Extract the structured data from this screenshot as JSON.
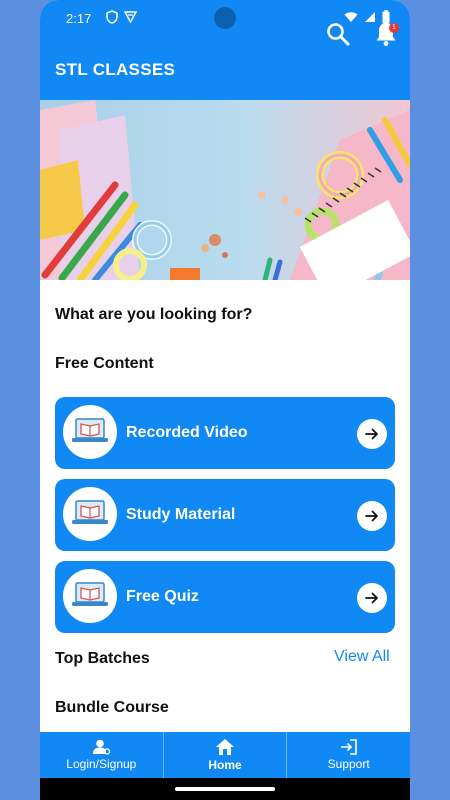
{
  "status": {
    "time": "2:17",
    "left_icons": [
      "shield-icon",
      "vpn-icon"
    ],
    "right_icons": [
      "wifi-icon",
      "signal-icon",
      "battery-icon"
    ]
  },
  "appbar": {
    "title": "STL CLASSES",
    "notification_count": "1",
    "icons": [
      "search-icon",
      "bell-icon"
    ]
  },
  "main": {
    "looking_for": "What are you looking for?",
    "free_content_heading": "Free Content",
    "cards": [
      {
        "label": "Recorded Video",
        "icon": "laptop-book-icon"
      },
      {
        "label": "Study Material",
        "icon": "laptop-book-icon"
      },
      {
        "label": "Free Quiz",
        "icon": "laptop-book-icon"
      }
    ],
    "top_batches_heading": "Top Batches",
    "view_all": "View All",
    "bundle_course_heading": "Bundle Course"
  },
  "bottom_nav": [
    {
      "label": "Login/Signup",
      "icon": "user-icon"
    },
    {
      "label": "Home",
      "icon": "home-icon",
      "active": true
    },
    {
      "label": "Support",
      "icon": "login-arrow-icon"
    }
  ],
  "colors": {
    "primary": "#1189f4",
    "background": "#5b8fe0",
    "badge": "#e53935"
  }
}
